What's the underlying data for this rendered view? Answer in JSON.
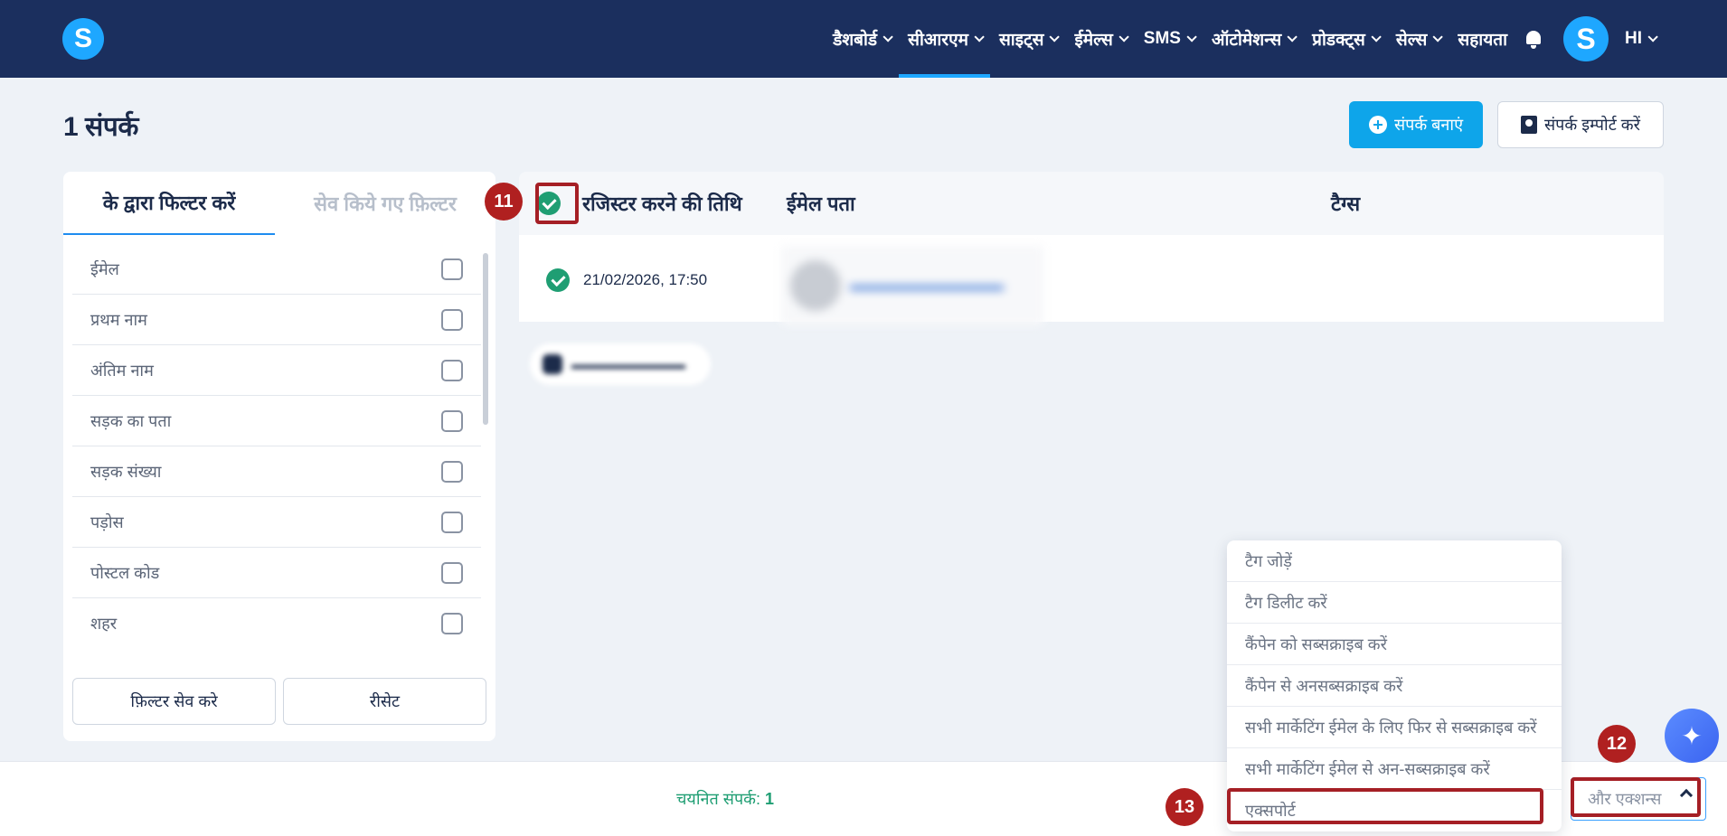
{
  "nav": {
    "logo": "S",
    "items": [
      {
        "label": "डैशबोर्ड",
        "chevron": true,
        "active": false
      },
      {
        "label": "सीआरएम",
        "chevron": true,
        "active": true
      },
      {
        "label": "साइट्स",
        "chevron": true,
        "active": false
      },
      {
        "label": "ईमेल्स",
        "chevron": true,
        "active": false
      },
      {
        "label": "SMS",
        "chevron": true,
        "active": false
      },
      {
        "label": "ऑटोमेशन्स",
        "chevron": true,
        "active": false
      },
      {
        "label": "प्रोडक्ट्स",
        "chevron": true,
        "active": false
      },
      {
        "label": "सेल्स",
        "chevron": true,
        "active": false
      },
      {
        "label": "सहायता",
        "chevron": false,
        "active": false
      }
    ],
    "avatar": "S",
    "language": "HI"
  },
  "page": {
    "title": "1 संपर्क",
    "create_button": "संपर्क बनाएं",
    "import_button": "संपर्क इम्पोर्ट करें"
  },
  "filters": {
    "tab_active": "के द्वारा फिल्टर करें",
    "tab_saved": "सेव किये गए फ़िल्टर",
    "fields": [
      "ईमेल",
      "प्रथम नाम",
      "अंतिम नाम",
      "सड़क का पता",
      "सड़क संख्या",
      "पड़ोस",
      "पोस्टल कोड",
      "शहर"
    ],
    "save_button": "फ़िल्टर सेव करे",
    "reset_button": "रीसेट"
  },
  "table": {
    "headers": {
      "registered": "रजिस्टर करने की तिथि",
      "email": "ईमेल पता",
      "tags": "टैग्स"
    },
    "rows": [
      {
        "date": "21/02/2026, 17:50"
      }
    ]
  },
  "annotations": {
    "m11": "11",
    "m12": "12",
    "m13": "13"
  },
  "bottom": {
    "selected_label": "चयनित संपर्क:",
    "selected_count": "1",
    "more_actions": "और एक्शन्स"
  },
  "menu": {
    "items": [
      "टैग जोड़ें",
      "टैग डिलीट करें",
      "कैंपेन को सब्सक्राइब करें",
      "कैंपेन से अनसब्सक्राइब करें",
      "सभी मार्केटिंग ईमेल के लिए फिर से सब्सक्राइब करें",
      "सभी मार्केटिंग ईमेल से अन-सब्सक्राइब करें",
      "एक्सपोर्ट"
    ]
  },
  "colors": {
    "nav_bg": "#1b2f5e",
    "accent": "#1ea7ff",
    "success": "#1f9e73",
    "annotation": "#a51f25"
  }
}
